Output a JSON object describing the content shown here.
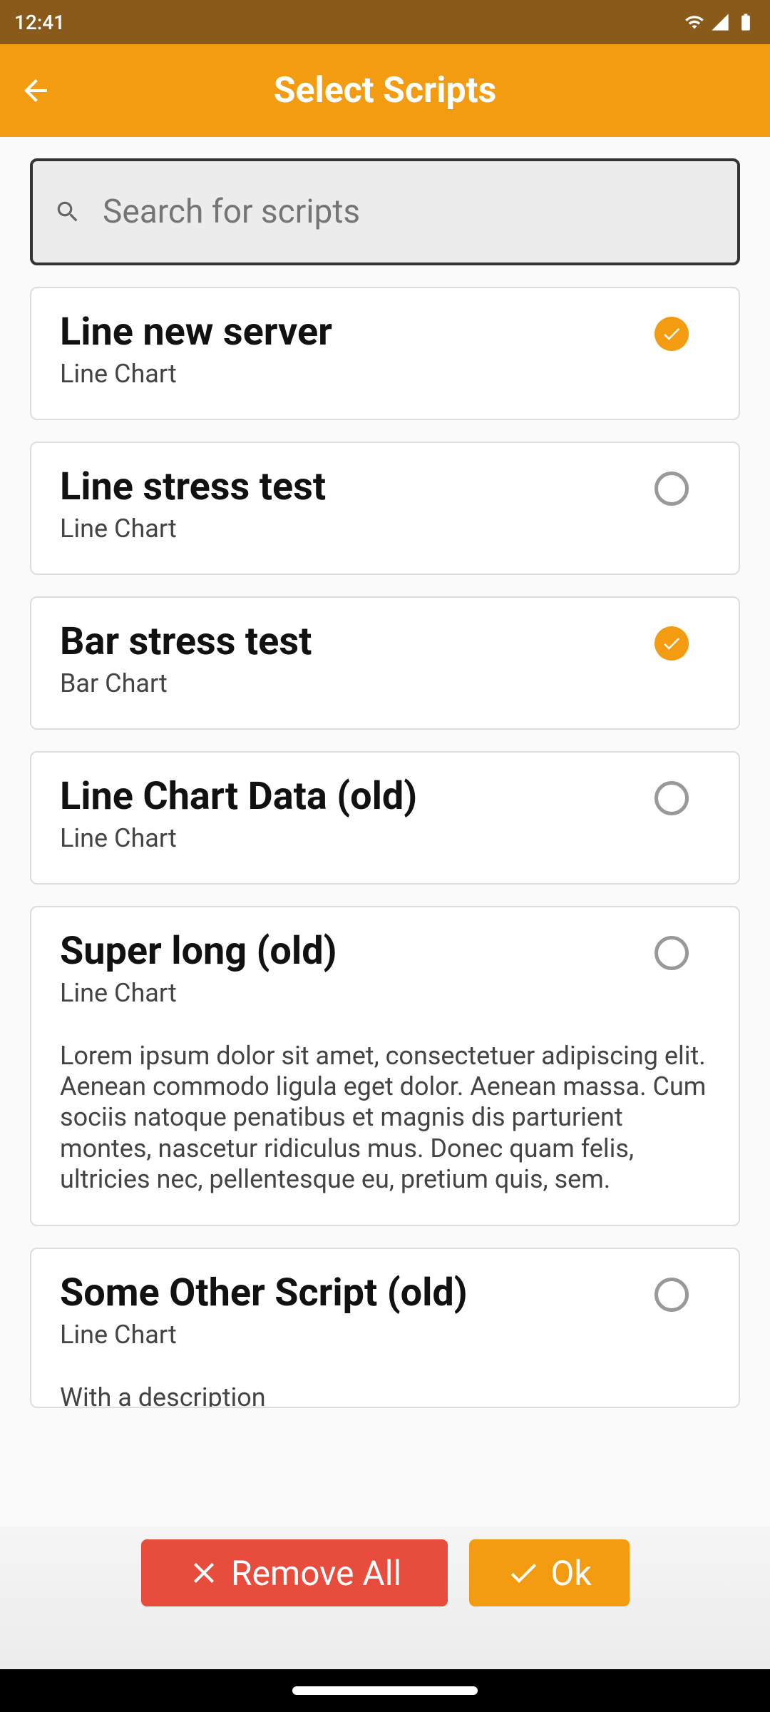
{
  "status": {
    "time": "12:41"
  },
  "header": {
    "title": "Select Scripts"
  },
  "search": {
    "placeholder": "Search for scripts"
  },
  "scripts": [
    {
      "title": "Line new server",
      "subtitle": "Line Chart",
      "selected": true,
      "desc": ""
    },
    {
      "title": "Line stress test",
      "subtitle": "Line Chart",
      "selected": false,
      "desc": ""
    },
    {
      "title": "Bar stress test",
      "subtitle": "Bar Chart",
      "selected": true,
      "desc": ""
    },
    {
      "title": "Line Chart Data (old)",
      "subtitle": "Line Chart",
      "selected": false,
      "desc": ""
    },
    {
      "title": "Super long (old)",
      "subtitle": "Line Chart",
      "selected": false,
      "desc": "Lorem ipsum dolor sit amet, consectetuer adipiscing elit. Aenean commodo ligula eget dolor. Aenean massa. Cum sociis natoque penatibus et magnis dis parturient montes, nascetur ridiculus mus. Donec quam felis, ultricies nec, pellentesque eu, pretium quis, sem."
    },
    {
      "title": "Some Other Script (old)",
      "subtitle": "Line Chart",
      "selected": false,
      "desc": "With a description"
    }
  ],
  "actions": {
    "remove": "Remove All",
    "ok": "Ok"
  }
}
